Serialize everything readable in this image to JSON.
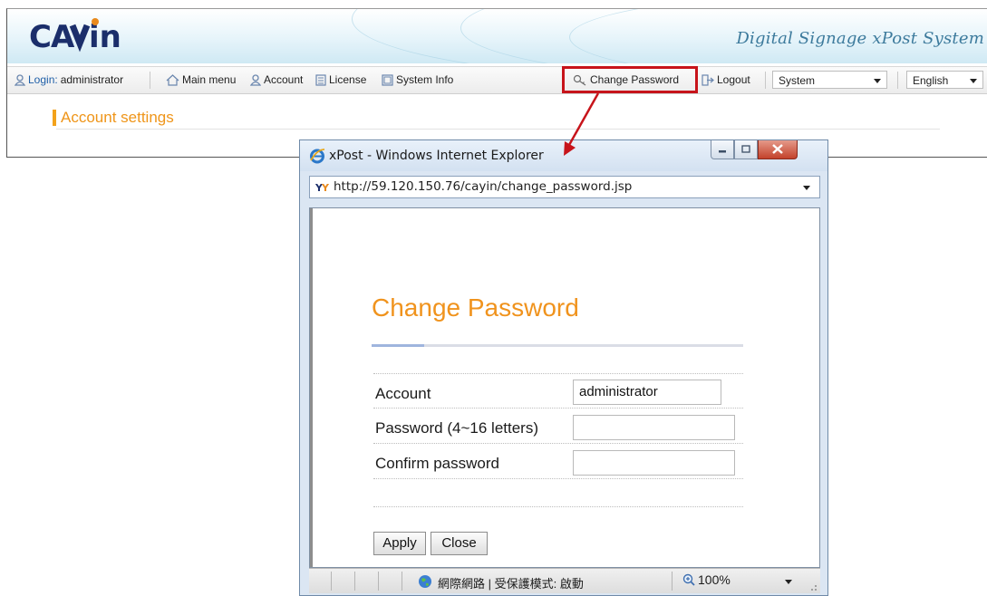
{
  "app": {
    "logo_text": "CAYIN",
    "tagline": "Digital Signage xPost System",
    "toolbar": {
      "login_label": "Login:",
      "login_user": "administrator",
      "main_menu": "Main menu",
      "account": "Account",
      "license": "License",
      "system_info": "System Info",
      "change_password": "Change Password",
      "logout": "Logout",
      "system_select": "System",
      "language_select": "English"
    },
    "page_title": "Account settings"
  },
  "popup": {
    "window_title": "xPost - Windows Internet Explorer",
    "url": "http://59.120.150.76/cayin/change_password.jsp",
    "heading": "Change Password",
    "fields": [
      {
        "label": "Account",
        "value": "administrator"
      },
      {
        "label": "Password (4~16 letters)",
        "value": ""
      },
      {
        "label": "Confirm password",
        "value": ""
      }
    ],
    "apply_label": "Apply",
    "close_label": "Close",
    "status_text": "網際網路 | 受保護模式: 啟動",
    "zoom": "100%"
  },
  "colors": {
    "accent_orange": "#f0931d",
    "highlight_red": "#c7141b",
    "link_blue": "#1f5fa8"
  }
}
